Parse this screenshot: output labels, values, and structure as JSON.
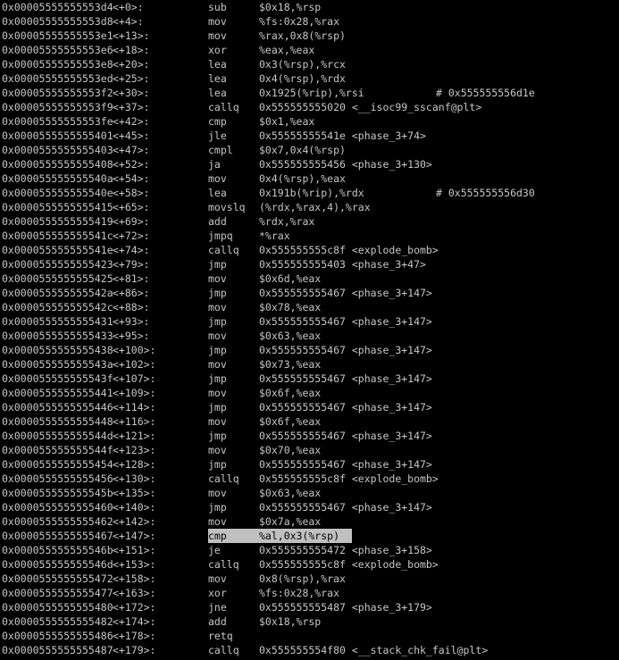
{
  "lines": [
    {
      "addr": "0x00005555555553d4",
      "off": "<+0>:",
      "mn": "sub",
      "ops": "$0x18,%rsp",
      "cmt": ""
    },
    {
      "addr": "0x00005555555553d8",
      "off": "<+4>:",
      "mn": "mov",
      "ops": "%fs:0x28,%rax",
      "cmt": ""
    },
    {
      "addr": "0x00005555555553e1",
      "off": "<+13>:",
      "mn": "mov",
      "ops": "%rax,0x8(%rsp)",
      "cmt": ""
    },
    {
      "addr": "0x00005555555553e6",
      "off": "<+18>:",
      "mn": "xor",
      "ops": "%eax,%eax",
      "cmt": ""
    },
    {
      "addr": "0x00005555555553e8",
      "off": "<+20>:",
      "mn": "lea",
      "ops": "0x3(%rsp),%rcx",
      "cmt": ""
    },
    {
      "addr": "0x00005555555553ed",
      "off": "<+25>:",
      "mn": "lea",
      "ops": "0x4(%rsp),%rdx",
      "cmt": ""
    },
    {
      "addr": "0x00005555555553f2",
      "off": "<+30>:",
      "mn": "lea",
      "ops": "0x1925(%rip),%rsi",
      "cmt": "# 0x555555556d1e"
    },
    {
      "addr": "0x00005555555553f9",
      "off": "<+37>:",
      "mn": "callq",
      "ops": "0x555555555020 <__isoc99_sscanf@plt>",
      "cmt": ""
    },
    {
      "addr": "0x00005555555553fe",
      "off": "<+42>:",
      "mn": "cmp",
      "ops": "$0x1,%eax",
      "cmt": ""
    },
    {
      "addr": "0x0000555555555401",
      "off": "<+45>:",
      "mn": "jle",
      "ops": "0x55555555541e <phase_3+74>",
      "cmt": ""
    },
    {
      "addr": "0x0000555555555403",
      "off": "<+47>:",
      "mn": "cmpl",
      "ops": "$0x7,0x4(%rsp)",
      "cmt": ""
    },
    {
      "addr": "0x0000555555555408",
      "off": "<+52>:",
      "mn": "ja",
      "ops": "0x555555555456 <phase_3+130>",
      "cmt": ""
    },
    {
      "addr": "0x000055555555540a",
      "off": "<+54>:",
      "mn": "mov",
      "ops": "0x4(%rsp),%eax",
      "cmt": ""
    },
    {
      "addr": "0x000055555555540e",
      "off": "<+58>:",
      "mn": "lea",
      "ops": "0x191b(%rip),%rdx",
      "cmt": "# 0x555555556d30"
    },
    {
      "addr": "0x0000555555555415",
      "off": "<+65>:",
      "mn": "movslq",
      "ops": "(%rdx,%rax,4),%rax",
      "cmt": ""
    },
    {
      "addr": "0x0000555555555419",
      "off": "<+69>:",
      "mn": "add",
      "ops": "%rdx,%rax",
      "cmt": ""
    },
    {
      "addr": "0x000055555555541c",
      "off": "<+72>:",
      "mn": "jmpq",
      "ops": "*%rax",
      "cmt": ""
    },
    {
      "addr": "0x000055555555541e",
      "off": "<+74>:",
      "mn": "callq",
      "ops": "0x555555555c8f <explode_bomb>",
      "cmt": ""
    },
    {
      "addr": "0x0000555555555423",
      "off": "<+79>:",
      "mn": "jmp",
      "ops": "0x555555555403 <phase_3+47>",
      "cmt": ""
    },
    {
      "addr": "0x0000555555555425",
      "off": "<+81>:",
      "mn": "mov",
      "ops": "$0x6d,%eax",
      "cmt": ""
    },
    {
      "addr": "0x000055555555542a",
      "off": "<+86>:",
      "mn": "jmp",
      "ops": "0x555555555467 <phase_3+147>",
      "cmt": ""
    },
    {
      "addr": "0x000055555555542c",
      "off": "<+88>:",
      "mn": "mov",
      "ops": "$0x78,%eax",
      "cmt": ""
    },
    {
      "addr": "0x0000555555555431",
      "off": "<+93>:",
      "mn": "jmp",
      "ops": "0x555555555467 <phase_3+147>",
      "cmt": ""
    },
    {
      "addr": "0x0000555555555433",
      "off": "<+95>:",
      "mn": "mov",
      "ops": "$0x63,%eax",
      "cmt": ""
    },
    {
      "addr": "0x0000555555555438",
      "off": "<+100>:",
      "mn": "jmp",
      "ops": "0x555555555467 <phase_3+147>",
      "cmt": ""
    },
    {
      "addr": "0x000055555555543a",
      "off": "<+102>:",
      "mn": "mov",
      "ops": "$0x73,%eax",
      "cmt": ""
    },
    {
      "addr": "0x000055555555543f",
      "off": "<+107>:",
      "mn": "jmp",
      "ops": "0x555555555467 <phase_3+147>",
      "cmt": ""
    },
    {
      "addr": "0x0000555555555441",
      "off": "<+109>:",
      "mn": "mov",
      "ops": "$0x6f,%eax",
      "cmt": ""
    },
    {
      "addr": "0x0000555555555446",
      "off": "<+114>:",
      "mn": "jmp",
      "ops": "0x555555555467 <phase_3+147>",
      "cmt": ""
    },
    {
      "addr": "0x0000555555555448",
      "off": "<+116>:",
      "mn": "mov",
      "ops": "$0x6f,%eax",
      "cmt": ""
    },
    {
      "addr": "0x000055555555544d",
      "off": "<+121>:",
      "mn": "jmp",
      "ops": "0x555555555467 <phase_3+147>",
      "cmt": ""
    },
    {
      "addr": "0x000055555555544f",
      "off": "<+123>:",
      "mn": "mov",
      "ops": "$0x70,%eax",
      "cmt": ""
    },
    {
      "addr": "0x0000555555555454",
      "off": "<+128>:",
      "mn": "jmp",
      "ops": "0x555555555467 <phase_3+147>",
      "cmt": ""
    },
    {
      "addr": "0x0000555555555456",
      "off": "<+130>:",
      "mn": "callq",
      "ops": "0x555555555c8f <explode_bomb>",
      "cmt": ""
    },
    {
      "addr": "0x000055555555545b",
      "off": "<+135>:",
      "mn": "mov",
      "ops": "$0x63,%eax",
      "cmt": ""
    },
    {
      "addr": "0x0000555555555460",
      "off": "<+140>:",
      "mn": "jmp",
      "ops": "0x555555555467 <phase_3+147>",
      "cmt": ""
    },
    {
      "addr": "0x0000555555555462",
      "off": "<+142>:",
      "mn": "mov",
      "ops": "$0x7a,%eax",
      "cmt": ""
    },
    {
      "addr": "0x0000555555555467",
      "off": "<+147>:",
      "mn": "cmp",
      "ops": "%al,0x3(%rsp)",
      "cmt": "",
      "selected": true
    },
    {
      "addr": "0x000055555555546b",
      "off": "<+151>:",
      "mn": "je",
      "ops": "0x555555555472 <phase_3+158>",
      "cmt": ""
    },
    {
      "addr": "0x000055555555546d",
      "off": "<+153>:",
      "mn": "callq",
      "ops": "0x555555555c8f <explode_bomb>",
      "cmt": ""
    },
    {
      "addr": "0x0000555555555472",
      "off": "<+158>:",
      "mn": "mov",
      "ops": "0x8(%rsp),%rax",
      "cmt": ""
    },
    {
      "addr": "0x0000555555555477",
      "off": "<+163>:",
      "mn": "xor",
      "ops": "%fs:0x28,%rax",
      "cmt": ""
    },
    {
      "addr": "0x0000555555555480",
      "off": "<+172>:",
      "mn": "jne",
      "ops": "0x555555555487 <phase_3+179>",
      "cmt": ""
    },
    {
      "addr": "0x0000555555555482",
      "off": "<+174>:",
      "mn": "add",
      "ops": "$0x18,%rsp",
      "cmt": ""
    },
    {
      "addr": "0x0000555555555486",
      "off": "<+178>:",
      "mn": "retq",
      "ops": "",
      "cmt": ""
    },
    {
      "addr": "0x0000555555555487",
      "off": "<+179>:",
      "mn": "callq",
      "ops": "0x555555554f80 <__stack_chk_fail@plt>",
      "cmt": ""
    }
  ]
}
